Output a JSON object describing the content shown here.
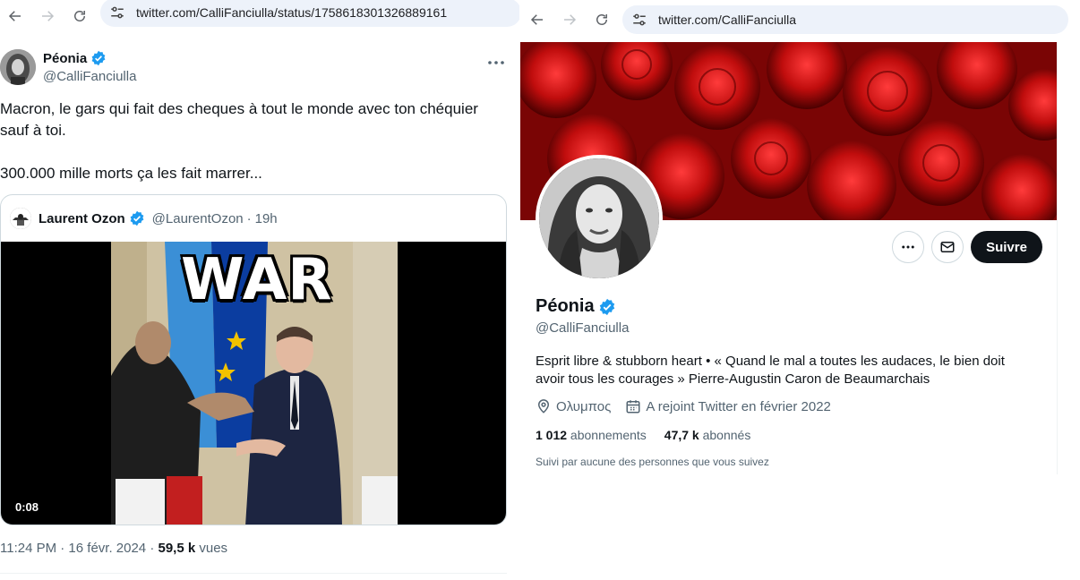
{
  "left": {
    "url": "twitter.com/CalliFanciulla/status/1758618301326889161",
    "tweet": {
      "name": "Péonia",
      "handle": "@CalliFanciulla",
      "text_line1": "Macron, le gars qui fait des cheques à tout le monde avec ton chéquier sauf à toi.",
      "text_line2": "300.000 mille morts ça les fait marrer...",
      "quote": {
        "name": "Laurent Ozon",
        "handle": "@LaurentOzon",
        "time": "19h",
        "video_caption": "WAR",
        "video_duration": "0:08"
      },
      "timestamp": "11:24 PM · 16 févr. 2024 · ",
      "views_count": "59,5 k",
      "views_label": " vues"
    }
  },
  "right": {
    "url": "twitter.com/CalliFanciulla",
    "profile": {
      "follow_label": "Suivre",
      "name": "Péonia",
      "handle": "@CalliFanciulla",
      "bio": "Esprit libre & stubborn heart • « Quand le mal a toutes les audaces, le bien doit avoir tous les courages » Pierre-Augustin Caron de Beaumarchais",
      "location": "Ολυμπος",
      "joined": "A rejoint Twitter en février 2022",
      "following_count": "1 012",
      "following_label": " abonnements",
      "followers_count": "47,7 k",
      "followers_label": " abonnés",
      "followed_by": "Suivi par aucune des personnes que vous suivez"
    }
  },
  "colors": {
    "verified": "#1d9bf0",
    "secondary_text": "#536471",
    "follow_button": "#0f1419",
    "url_bar": "#edf2fa"
  },
  "icons": [
    "back-arrow-icon",
    "forward-arrow-icon",
    "reload-icon",
    "site-settings-icon",
    "verified-badge-icon",
    "more-icon",
    "mail-icon",
    "location-icon",
    "calendar-icon"
  ]
}
